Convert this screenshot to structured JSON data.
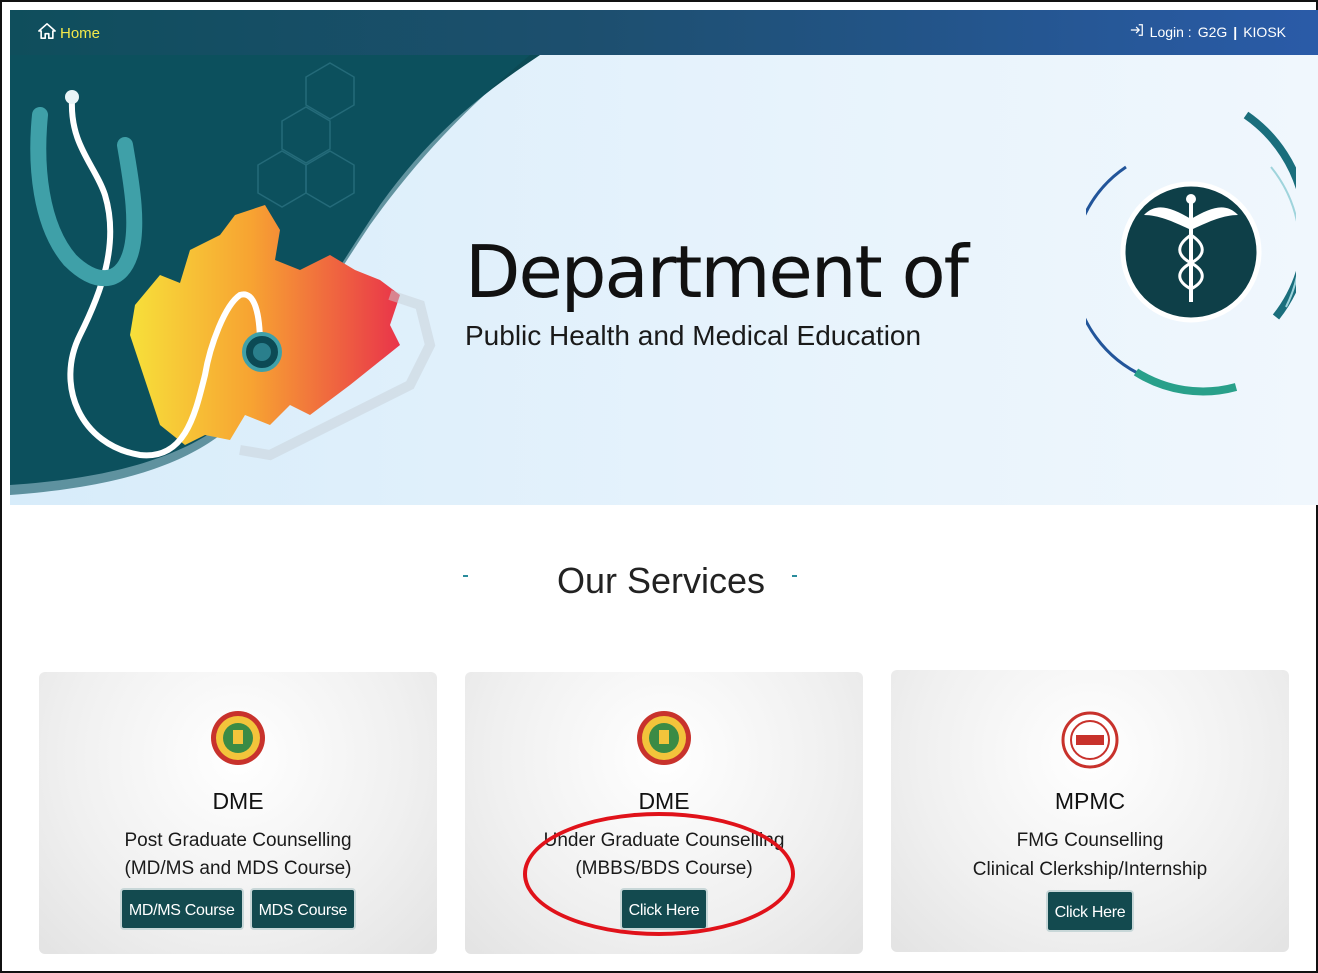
{
  "nav": {
    "home_label": "Home",
    "login_prefix": "Login :",
    "login_g2g": "G2G",
    "login_sep": "|",
    "login_kiosk": "KIOSK"
  },
  "banner": {
    "title": "Department of",
    "subtitle": "Public Health and Medical Education"
  },
  "services": {
    "heading": "Our Services",
    "cards": [
      {
        "org": "DME",
        "line1": "Post Graduate Counselling",
        "line2": "(MD/MS and MDS Course)",
        "buttons": [
          "MD/MS Course",
          "MDS Course"
        ]
      },
      {
        "org": "DME",
        "line1": "Under Graduate Counselling",
        "line2": "(MBBS/BDS Course)",
        "buttons": [
          "Click Here"
        ]
      },
      {
        "org": "MPMC",
        "line1": "FMG Counselling",
        "line2": "Clinical Clerkship/Internship",
        "buttons": [
          "Click Here"
        ]
      }
    ]
  },
  "colors": {
    "topbar_start": "#0f4e5c",
    "topbar_end": "#2a5ba8",
    "home_link": "#f4e94a",
    "button_bg": "#134a4f",
    "annotation": "#e0121a"
  },
  "icons": {
    "home": "home-icon",
    "login": "login-arrow-icon",
    "emblem": "caduceus-icon"
  }
}
